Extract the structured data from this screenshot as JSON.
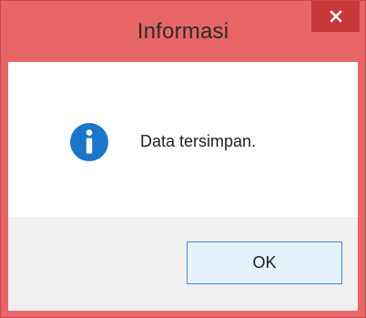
{
  "window": {
    "title": "Informasi",
    "close_icon": "close-icon"
  },
  "dialog": {
    "icon": "info-icon",
    "message": "Data tersimpan.",
    "ok_label": "OK"
  },
  "colors": {
    "frame": "#e86667",
    "close_button": "#c7383a",
    "icon": "#1a76c8",
    "button_border": "#3c8fdd",
    "button_bg": "#e5f1fb"
  }
}
